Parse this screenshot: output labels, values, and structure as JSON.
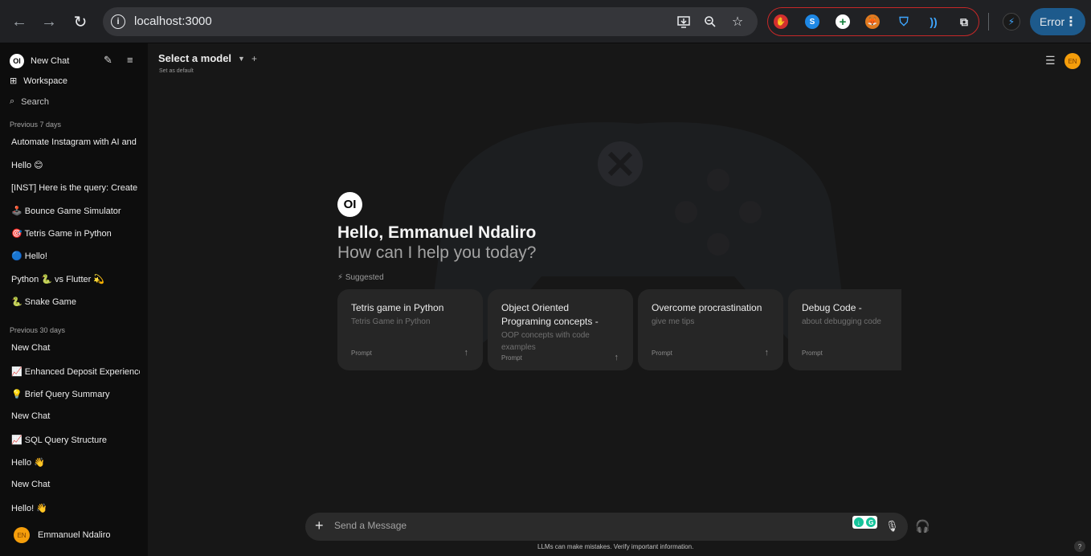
{
  "browser": {
    "url": "localhost:3000",
    "error_label": "Error",
    "icons": [
      "back-arrow-icon",
      "forward-arrow-icon",
      "reload-icon",
      "site-info-icon",
      "install-app-icon",
      "zoom-icon",
      "bookmark-star-icon",
      "extensions-puzzle-icon",
      "kebab-menu-icon"
    ]
  },
  "sidebar": {
    "new_chat": "New Chat",
    "workspace": "Workspace",
    "search": "Search",
    "section_7_days": "Previous 7 days",
    "items_7_days": [
      "Automate Instagram with AI and",
      "Hello 😊",
      "[INST] Here is the query: Create",
      "🕹️ Bounce Game Simulator",
      "🎯 Tetris Game in Python",
      "🔵 Hello!",
      "Python 🐍 vs Flutter 💫",
      "🐍 Snake Game"
    ],
    "section_30_days": "Previous 30 days",
    "items_30_days": [
      "New Chat",
      "📈 Enhanced Deposit Experience",
      "💡 Brief Query Summary",
      "New Chat",
      "📈 SQL Query Structure",
      "Hello 👋",
      "New Chat",
      "Hello! 👋"
    ],
    "user_initials": "EN",
    "user_name": "Emmanuel Ndaliro"
  },
  "header": {
    "model_select": "Select a model",
    "set_default": "Set as default",
    "avatar_initials": "EN"
  },
  "logo_text": "OI",
  "greeting": "Hello, Emmanuel Ndaliro",
  "subgreeting": "How can I help you today?",
  "suggested_label": "Suggested",
  "suggestions": [
    {
      "title": "Tetris game in Python",
      "subtitle": "Tetris Game in Python",
      "footer": "Prompt"
    },
    {
      "title": "Object Oriented Programing concepts -",
      "subtitle": "OOP concepts with code examples",
      "footer": "Prompt"
    },
    {
      "title": "Overcome procrastination",
      "subtitle": "give me tips",
      "footer": "Prompt"
    },
    {
      "title": "Debug Code -",
      "subtitle": "about debugging code",
      "footer": "Prompt"
    }
  ],
  "composer": {
    "placeholder": "Send a Message",
    "disclaimer": "LLMs can make mistakes. Verify important information.",
    "help": "?"
  }
}
